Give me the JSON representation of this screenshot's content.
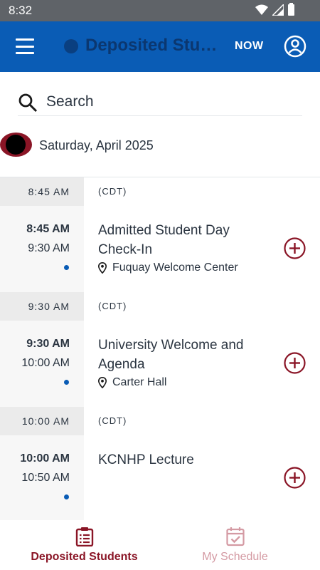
{
  "status_bar": {
    "time": "8:32"
  },
  "app_bar": {
    "title": "Deposited Stud...",
    "now_label": "NOW"
  },
  "search": {
    "placeholder": "Search"
  },
  "date_header": {
    "label": "Saturday, April 2025"
  },
  "schedule": {
    "groups": [
      {
        "header_time": "8:45 AM",
        "timezone": "(CDT)",
        "session": {
          "start": "8:45 AM",
          "end": "9:30 AM",
          "title": "Admitted Student Day Check-In",
          "location": "Fuquay Welcome Center"
        }
      },
      {
        "header_time": "9:30 AM",
        "timezone": "(CDT)",
        "session": {
          "start": "9:30 AM",
          "end": "10:00 AM",
          "title": "University Welcome and Agenda",
          "location": "Carter Hall"
        }
      },
      {
        "header_time": "10:00 AM",
        "timezone": "(CDT)",
        "session": {
          "start": "10:00 AM",
          "end": "10:50 AM",
          "title": "KCNHP Lecture",
          "location": ""
        }
      }
    ]
  },
  "bottom_nav": {
    "items": [
      {
        "label": "Deposited Students",
        "icon": "clipboard-list-icon",
        "active": true
      },
      {
        "label": "My Schedule",
        "icon": "calendar-check-icon",
        "active": false
      }
    ]
  },
  "colors": {
    "app_bar": "#0a5cb5",
    "accent": "#8a1526",
    "dot": "#0a5cb5",
    "status_bar": "#5f6368"
  }
}
